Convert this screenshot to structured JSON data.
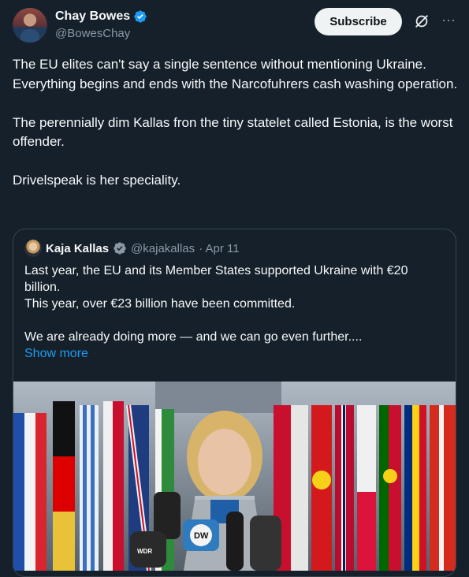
{
  "author": {
    "name": "Chay Bowes",
    "handle": "@BowesChay"
  },
  "actions": {
    "subscribe_label": "Subscribe",
    "more_label": "···"
  },
  "tweet": {
    "paragraphs": [
      "The EU elites can't say a single sentence without mentioning Ukraine. Everything begins and ends with the Narcofuhrers cash washing operation.",
      "The perennially dim Kallas fron the tiny statelet called Estonia, is the worst offender.",
      "Drivelspeak is her speciality."
    ]
  },
  "quote": {
    "name": "Kaja Kallas",
    "handle": "@kajakallas",
    "date": "· Apr 11",
    "lines": [
      "Last year, the EU and its Member States supported Ukraine with €20 billion.",
      "This year, over €23 billion have been committed.",
      "",
      "We are already doing more — and we can go even further...."
    ],
    "show_more": "Show more",
    "image_labels": {
      "mic1": "WDR",
      "mic2": "DW"
    }
  },
  "colors": {
    "background": "#15202b",
    "text": "#f7f9f9",
    "muted": "#8b98a5",
    "link": "#1d9bf0",
    "border": "#38444d",
    "verified": "#1d9bf0"
  }
}
